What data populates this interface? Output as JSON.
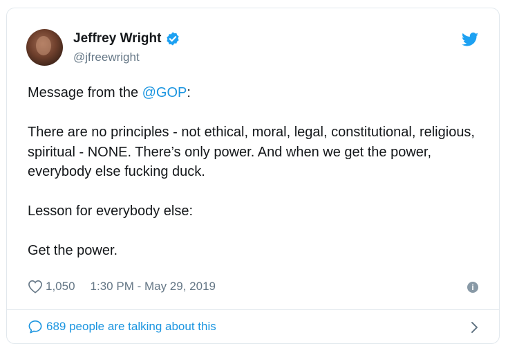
{
  "author": {
    "name": "Jeffrey Wright",
    "handle": "@jfreewright"
  },
  "icons": {
    "verified": "verified-badge-icon",
    "logo": "twitter-bird-icon",
    "like": "heart-icon",
    "info": "info-icon",
    "reply": "speech-bubble-icon",
    "chevron": "chevron-right-icon"
  },
  "tweet": {
    "line1_prefix": "Message from the ",
    "line1_mention": "@GOP",
    "line1_suffix": ":",
    "paragraph2": "There are no principles - not ethical, moral, legal, constitutional, religious, spiritual - NONE. There’s only power. And when we get the power, everybody else fucking duck.",
    "paragraph3": "Lesson for everybody else:",
    "paragraph4": "Get the power."
  },
  "meta": {
    "likes": "1,050",
    "timestamp": "1:30 PM - May 29, 2019"
  },
  "footer": {
    "talking": "689 people are talking about this"
  },
  "colors": {
    "link": "#1b95e0",
    "secondary": "#657786",
    "border": "#e1e8ed"
  }
}
